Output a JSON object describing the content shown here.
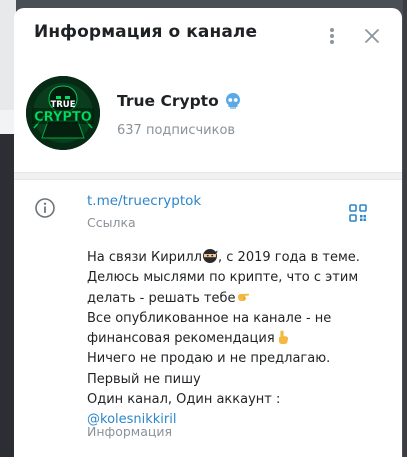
{
  "header": {
    "title": "Информация о канале",
    "more_icon": "more-vertical-icon",
    "close_icon": "close-icon"
  },
  "channel": {
    "name": "True Crypto",
    "name_emoji": "skull-emoji",
    "subscribers": "637 подписчиков",
    "avatar": {
      "line1": "TRUE",
      "line2": "CRYPTO"
    }
  },
  "link_row": {
    "icon": "info-icon",
    "url": "t.me/truecryptok",
    "label": "Ссылка",
    "qr_icon": "qr-code-icon"
  },
  "description": {
    "line1_a": "На связи Кирилл",
    "line1_b": ", с 2019 года в теме.",
    "line2": "Делюсь мыслями по крипте, что с этим",
    "line3_a": "делать - решать тебе",
    "line4": "Все опубликованное на канале - не",
    "line5_a": "финансовая рекомендация",
    "line6": "Ничего не продаю и не предлагаю.",
    "line7": "Первый не пишу",
    "line8": "Один канал, Один аккаунт :",
    "mention": "@kolesnikkiril",
    "label": "Информация"
  },
  "colors": {
    "accent": "#2d86c8",
    "secondary_text": "#8a9299",
    "avatar_green": "#00e060",
    "avatar_bg": "#062a14"
  }
}
